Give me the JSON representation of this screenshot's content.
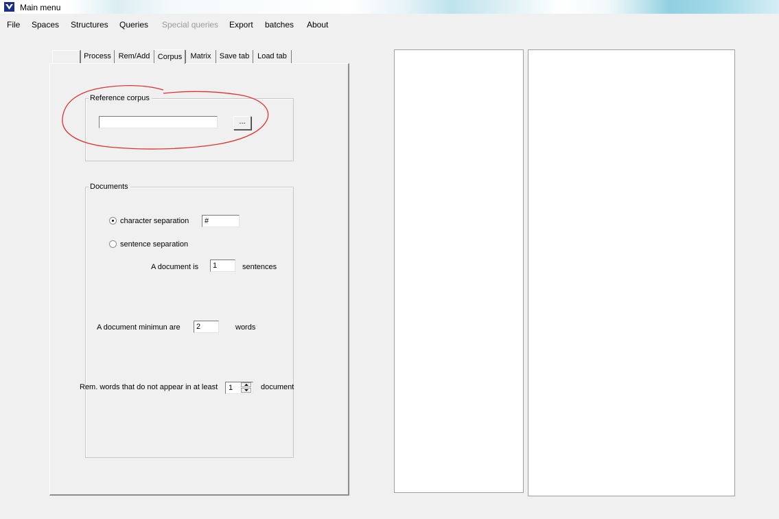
{
  "window": {
    "title": "Main menu",
    "icon": "app-icon"
  },
  "menu": [
    {
      "label": "File",
      "disabled": false
    },
    {
      "label": "Spaces",
      "disabled": false
    },
    {
      "label": "Structures",
      "disabled": false
    },
    {
      "label": "Queries",
      "disabled": false
    },
    {
      "label": "Special queries",
      "disabled": true
    },
    {
      "label": "Export",
      "disabled": false
    },
    {
      "label": "batches",
      "disabled": false
    },
    {
      "label": "About",
      "disabled": false
    }
  ],
  "tabs": [
    {
      "label": "",
      "active": false
    },
    {
      "label": "Process",
      "active": false
    },
    {
      "label": "Rem/Add",
      "active": false
    },
    {
      "label": "Corpus",
      "active": true
    },
    {
      "label": "Matrix",
      "active": false
    },
    {
      "label": "Save tab",
      "active": false
    },
    {
      "label": "Load tab",
      "active": false
    }
  ],
  "reference_corpus": {
    "title": "Reference corpus",
    "path_value": "",
    "browse_label": "..."
  },
  "documents": {
    "title": "Documents",
    "char_sep_label": "character separation",
    "char_sep_value": "#",
    "char_sep_selected": true,
    "sentence_sep_label": "sentence separation",
    "sentence_sep_selected": false,
    "doc_is_label": "A document is",
    "doc_is_value": "1",
    "sentences_label": "sentences",
    "min_label": "A document minimun are",
    "min_value": "2",
    "words_label": "words",
    "rem_label": "Rem. words that do not appear in at least",
    "rem_value": "1",
    "document_label": "document"
  },
  "colors": {
    "annotation": "#e0302f",
    "background": "#f0f0f0"
  }
}
